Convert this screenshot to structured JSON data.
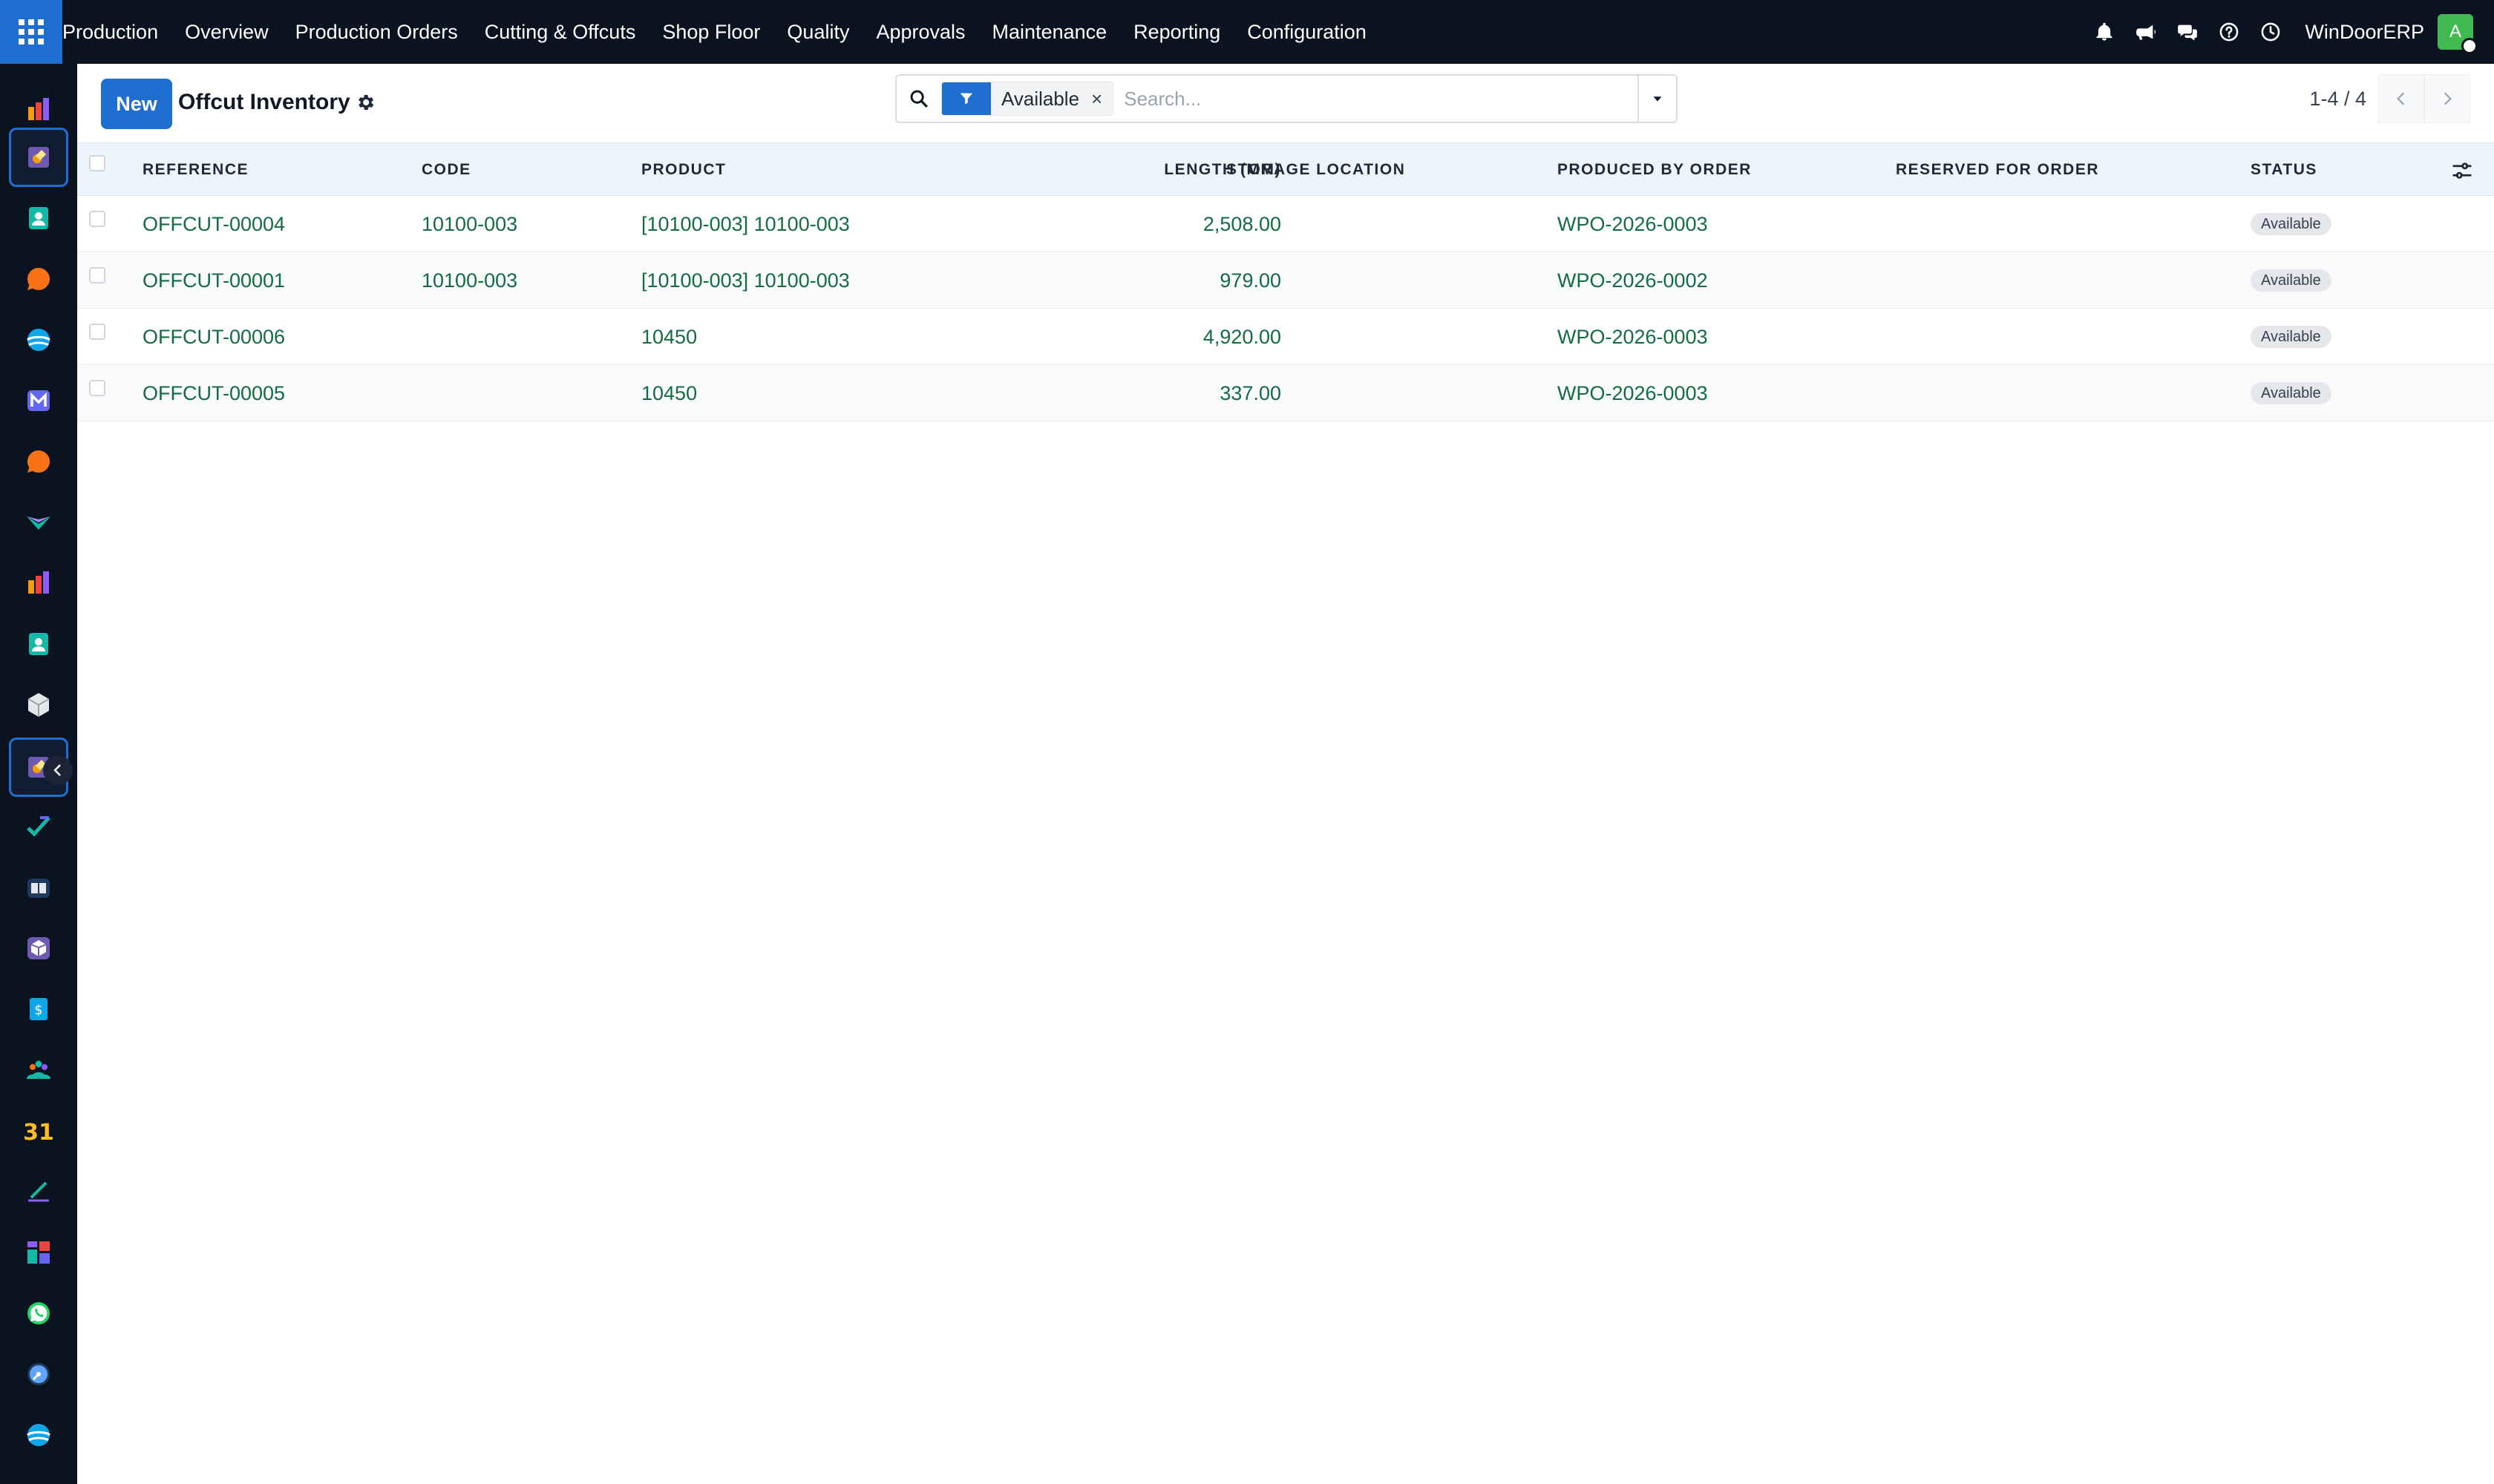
{
  "topbar": {
    "app_name": "Production",
    "menu": [
      "Overview",
      "Production Orders",
      "Cutting & Offcuts",
      "Shop Floor",
      "Quality",
      "Approvals",
      "Maintenance",
      "Reporting",
      "Configuration"
    ],
    "company": "WinDoorERP",
    "avatar_initial": "A",
    "icons": [
      "bell-icon",
      "megaphone-icon",
      "chat-icon",
      "help-icon",
      "clock-icon"
    ]
  },
  "dock": {
    "icons": [
      "production-icon",
      "offcuts-icon",
      "contacts-icon",
      "discuss-icon",
      "helpdesk-icon",
      "mail-icon",
      "chat-icon",
      "reporting-icon",
      "employees-icon",
      "inventory-icon",
      "manufacturing-icon",
      "project-icon",
      "knowledge-icon",
      "quality-icon",
      "invoicing-icon",
      "teams-icon",
      "calendar-icon",
      "sign-icon",
      "dashboard-icon",
      "whatsapp-icon",
      "timer-icon",
      "website-icon"
    ]
  },
  "control_panel": {
    "new_label": "New",
    "title": "Offcut Inventory",
    "search": {
      "facet_value": "Available",
      "facet_remove": "×",
      "placeholder": "Search..."
    },
    "pager": "1-4 / 4"
  },
  "table": {
    "headers": {
      "reference": "REFERENCE",
      "code": "CODE",
      "product": "PRODUCT",
      "length": "LENGTH (MM)",
      "location": "STORAGE LOCATION",
      "produced_by": "PRODUCED BY ORDER",
      "reserved_for": "RESERVED FOR ORDER",
      "status": "STATUS"
    },
    "rows": [
      {
        "reference": "OFFCUT-00004",
        "code": "10100-003",
        "product": "[10100-003] 10100-003",
        "length": "2,508.00",
        "location": "",
        "produced_by": "WPO-2026-0003",
        "reserved_for": "",
        "status": "Available"
      },
      {
        "reference": "OFFCUT-00001",
        "code": "10100-003",
        "product": "[10100-003] 10100-003",
        "length": "979.00",
        "location": "",
        "produced_by": "WPO-2026-0002",
        "reserved_for": "",
        "status": "Available"
      },
      {
        "reference": "OFFCUT-00006",
        "code": "",
        "product": "10450",
        "length": "4,920.00",
        "location": "",
        "produced_by": "WPO-2026-0003",
        "reserved_for": "",
        "status": "Available"
      },
      {
        "reference": "OFFCUT-00005",
        "code": "",
        "product": "10450",
        "length": "337.00",
        "location": "",
        "produced_by": "WPO-2026-0003",
        "reserved_for": "",
        "status": "Available"
      }
    ]
  },
  "colors": {
    "navbar": "#0b1220",
    "primary": "#1f6fd1",
    "link_green": "#146c43",
    "header_bg": "#eef4fc"
  }
}
